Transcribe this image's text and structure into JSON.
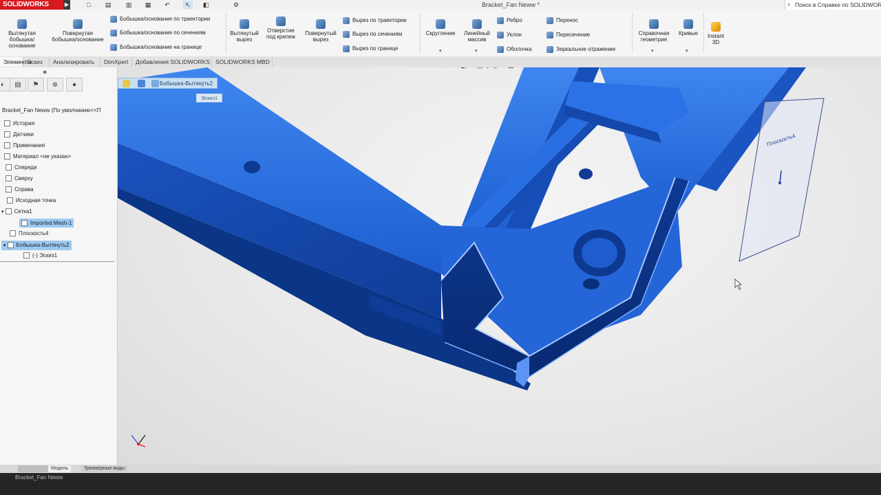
{
  "app": {
    "brand": "SOLIDWORKS",
    "document_title": "Bracket_Fan Neww *",
    "help_search": "Поиск в Справке по SOLIDWORKS"
  },
  "ribbon": {
    "extruded_boss": "Вытянутая бобышка/основание",
    "revolved_boss": "Повернутая бобышка/основание",
    "swept_boss": "Бобышка/основание по траектории",
    "lofted_boss": "Бобышка/основание по сечениям",
    "boundary_boss": "Бобышка/основание на границе",
    "extruded_cut": "Вытянутый вырез",
    "hole_wizard": "Отверстие под крепеж",
    "revolved_cut": "Повернутый вырез",
    "swept_cut": "Вырез по траектории",
    "lofted_cut": "Вырез по сечениям",
    "boundary_cut": "Вырез по границе",
    "fillet": "Скругление",
    "linear_pattern": "Линейный массив",
    "rib": "Ребро",
    "draft": "Уклон",
    "shell": "Оболочка",
    "wrap": "Перенос",
    "intersect": "Пересечение",
    "mirror": "Зеркальное отражение",
    "ref_geometry": "Справочная геометрия",
    "curves": "Кривые",
    "instant3d": "Instant 3D"
  },
  "tabs": [
    {
      "label": "Элементы"
    },
    {
      "label": "Эскиз"
    },
    {
      "label": "Анализировать"
    },
    {
      "label": "DimXpert"
    },
    {
      "label": "Добавления SOLIDWORKS"
    },
    {
      "label": "SOLIDWORKS MBD"
    }
  ],
  "tree": {
    "root": "Bracket_Fan Neww (По умолчанию<<П",
    "items": [
      {
        "label": "История"
      },
      {
        "label": "Датчики"
      },
      {
        "label": "Примечания"
      },
      {
        "label": "Материал <не указан>"
      },
      {
        "label": "Спереди"
      },
      {
        "label": "Сверху"
      },
      {
        "label": "Справа"
      },
      {
        "label": "Исходная точка"
      },
      {
        "label": "Сетка1"
      },
      {
        "label": "Imported Mesh-1"
      },
      {
        "label": "Плоскость4"
      },
      {
        "label": "Бобышка-Вытянуть2"
      },
      {
        "label": "(-) Эскиз1"
      }
    ]
  },
  "viewport": {
    "breadcrumb": "Бобышка-Вытянуть2",
    "breadcrumb_sub": "Эскиз1",
    "plane_label": "Плоскость4",
    "part_color": "#1f63d6"
  },
  "bottom_tabs": [
    {
      "label": "Модель"
    },
    {
      "label": "Трехмерные виды"
    }
  ],
  "status": {
    "doc": "Bracket_Fan Neww"
  }
}
